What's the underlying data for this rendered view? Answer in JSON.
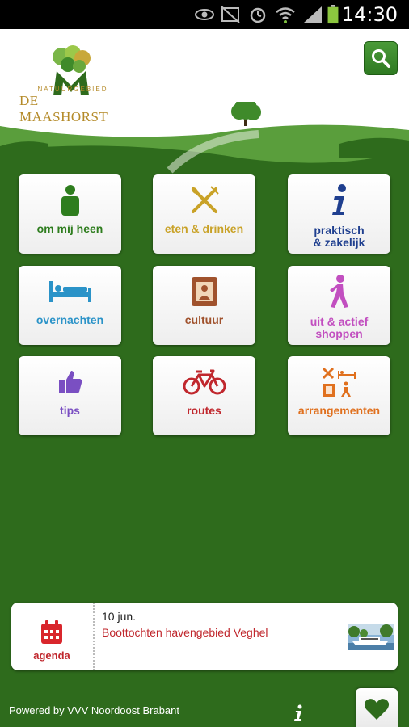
{
  "status_bar": {
    "time": "14:30"
  },
  "brand": {
    "tagline": "NATUURGEBIED",
    "name": "DE MAASHORST"
  },
  "header": {
    "search_icon": "magnifier-icon"
  },
  "tiles": [
    {
      "label": "om mij heen",
      "color": "#2e7d1e",
      "icon": "person-icon"
    },
    {
      "label": "eten & drinken",
      "color": "#c9a227",
      "icon": "fork-knife-icon"
    },
    {
      "label_line1": "praktisch",
      "label_line2": "& zakelijk",
      "color": "#1f3f8f",
      "icon": "info-icon"
    },
    {
      "label": "overnachten",
      "color": "#2b93c8",
      "icon": "bed-icon"
    },
    {
      "label": "cultuur",
      "color": "#a0522d",
      "icon": "picture-frame-icon"
    },
    {
      "label_line1": "uit & actief",
      "label_line2": "shoppen",
      "color": "#c24fc0",
      "icon": "walking-person-icon"
    },
    {
      "label": "tips",
      "color": "#7a4fc2",
      "icon": "thumbs-up-icon"
    },
    {
      "label": "routes",
      "color": "#c0272d",
      "icon": "bicycle-icon"
    },
    {
      "label": "arrangementen",
      "color": "#e0701e",
      "icon": "combo-icon"
    }
  ],
  "agenda": {
    "label": "agenda",
    "date": "10 jun.",
    "title": "Boottochten havengebied Veghel"
  },
  "footer": {
    "powered_by": "Powered by VVV Noordoost Brabant"
  }
}
